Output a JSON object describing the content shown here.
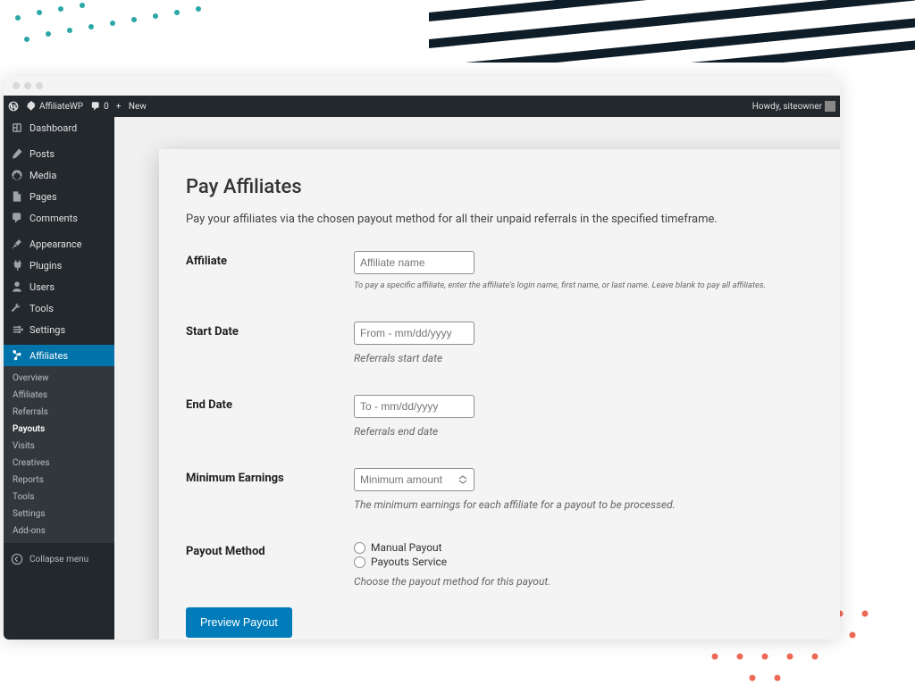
{
  "toolbar": {
    "site_name": "AffiliateWP",
    "comments_count": "0",
    "new_label": "New",
    "howdy": "Howdy, siteowner"
  },
  "sidebar": {
    "dashboard": "Dashboard",
    "posts": "Posts",
    "media": "Media",
    "pages": "Pages",
    "comments": "Comments",
    "appearance": "Appearance",
    "plugins": "Plugins",
    "users": "Users",
    "tools": "Tools",
    "settings": "Settings",
    "affiliates": "Affiliates",
    "sub": {
      "overview": "Overview",
      "affiliates": "Affiliates",
      "referrals": "Referrals",
      "payouts": "Payouts",
      "visits": "Visits",
      "creatives": "Creatives",
      "reports": "Reports",
      "tools": "Tools",
      "settings": "Settings",
      "addons": "Add-ons"
    },
    "collapse": "Collapse menu"
  },
  "page": {
    "title": "Pay Affiliates",
    "description": "Pay your affiliates via the chosen payout method for all their unpaid referrals in the specified timeframe.",
    "affiliate_label": "Affiliate",
    "affiliate_placeholder": "Affiliate name",
    "affiliate_help": "To pay a specific affiliate, enter the affiliate's login name, first name, or last name. Leave blank to pay all affiliates.",
    "start_label": "Start Date",
    "start_placeholder": "From - mm/dd/yyyy",
    "start_help": "Referrals start date",
    "end_label": "End Date",
    "end_placeholder": "To - mm/dd/yyyy",
    "end_help": "Referrals end date",
    "min_label": "Minimum Earnings",
    "min_placeholder": "Minimum amount",
    "min_help": "The minimum earnings for each affiliate for a payout to be processed.",
    "method_label": "Payout Method",
    "method_opt1": "Manual Payout",
    "method_opt2": "Payouts Service",
    "method_help": "Choose the payout method for this payout.",
    "submit": "Preview Payout"
  }
}
